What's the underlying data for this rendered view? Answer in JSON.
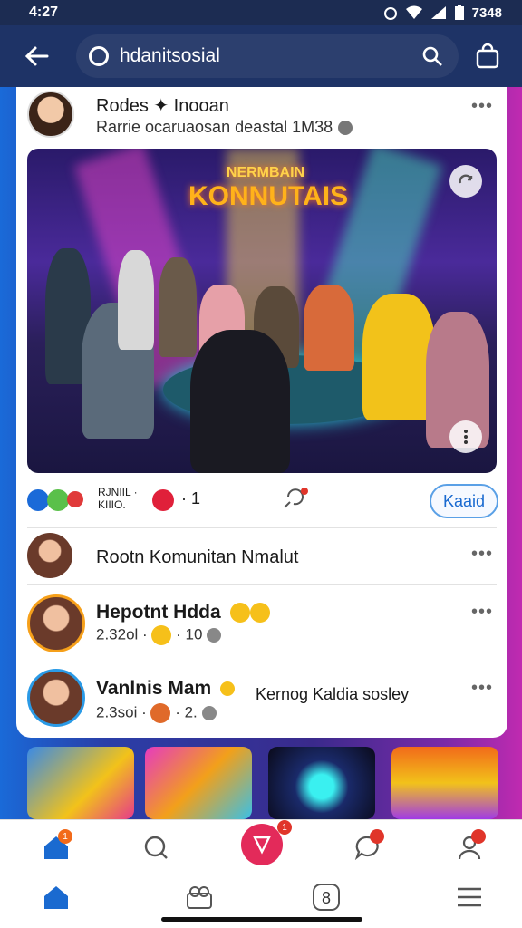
{
  "status_bar": {
    "time": "4:27",
    "right_text": "7348",
    "icons": [
      "alarm-icon",
      "wifi-icon",
      "signal-icon",
      "battery-icon"
    ]
  },
  "app_bar": {
    "search_value": "hdanitsosial",
    "icons": [
      "back-arrow-icon",
      "search-icon",
      "shopping-bag-icon"
    ]
  },
  "post": {
    "author": "Rodes ✦ Inooan",
    "subtitle": "Rarrie ocaruaosan deastal 1M38",
    "image_sign_line1": "NERMBAIN",
    "image_sign_line2": "KONNUTAIS",
    "reactions_text_line1": "RJNIIL ·",
    "reactions_text_line2": "KIIIO.",
    "reaction_count": "· 1",
    "join_label": "Kaaid",
    "colors": {
      "accent": "#1a6ad0",
      "badge": "#e0352a"
    }
  },
  "list": [
    {
      "title": "Rootn Komunitan Nmalut",
      "meta": ""
    },
    {
      "title": "Hepotnt Hdda",
      "meta_left": "2.32ol ·",
      "meta_right": "· 10"
    },
    {
      "title": "Vanlnis Mam",
      "extra": "Kernog Kaldia sosley",
      "meta_left": "2.3soi ·",
      "meta_right": "· 2."
    }
  ],
  "bottom_nav": {
    "items": [
      "home-icon",
      "explore-icon",
      "create-icon",
      "messages-icon",
      "profile-icon"
    ],
    "badges": [
      "1",
      "",
      "1",
      "",
      ""
    ]
  },
  "system_nav": {
    "items": [
      "home-icon",
      "people-icon",
      "app-icon",
      "menu-icon"
    ],
    "center_label": "8"
  }
}
